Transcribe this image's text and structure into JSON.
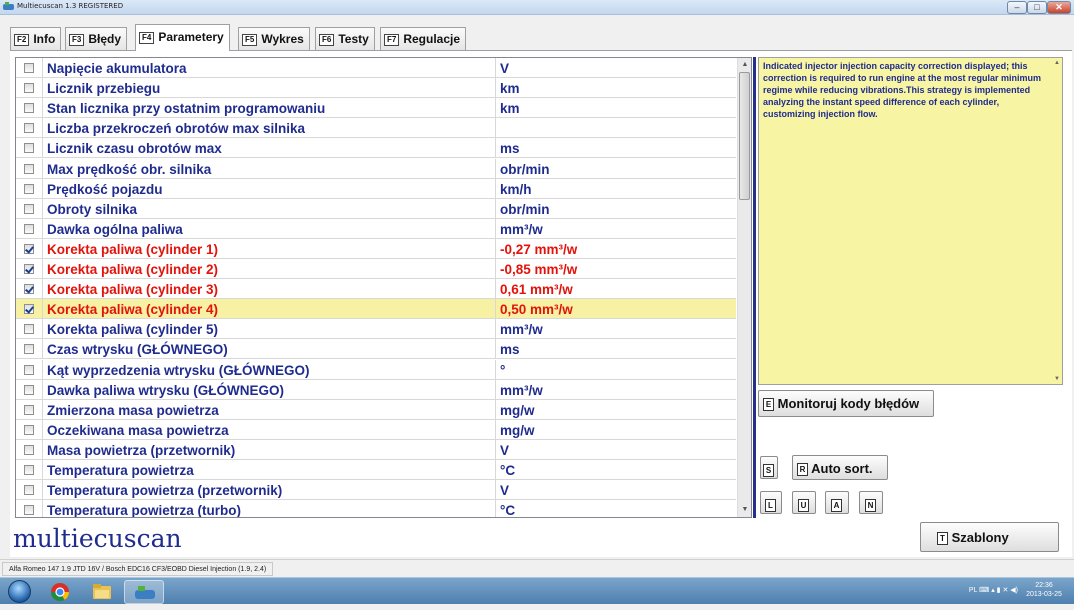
{
  "window": {
    "title": "Multiecuscan 1.3 REGISTERED",
    "minimize_glyph": "–",
    "maximize_glyph": "□",
    "close_glyph": "✕"
  },
  "tabs": [
    {
      "key": "F2",
      "label": "Info"
    },
    {
      "key": "F3",
      "label": "Błędy"
    },
    {
      "key": "F4",
      "label": "Parametery"
    },
    {
      "key": "F5",
      "label": "Wykres"
    },
    {
      "key": "F6",
      "label": "Testy"
    },
    {
      "key": "F7",
      "label": "Regulacje"
    }
  ],
  "params": [
    {
      "name": "Napięcie akumulatora",
      "value": "V",
      "checked": false
    },
    {
      "name": "Licznik przebiegu",
      "value": "km",
      "checked": false
    },
    {
      "name": "Stan licznika przy ostatnim programowaniu",
      "value": "km",
      "checked": false
    },
    {
      "name": "Liczba przekroczeń obrotów max silnika",
      "value": "",
      "checked": false
    },
    {
      "name": "Licznik czasu obrotów max",
      "value": "ms",
      "checked": false
    },
    {
      "name": "Max prędkość obr. silnika",
      "value": "obr/min",
      "checked": false
    },
    {
      "name": "Prędkość pojazdu",
      "value": "km/h",
      "checked": false
    },
    {
      "name": "Obroty silnika",
      "value": "obr/min",
      "checked": false
    },
    {
      "name": "Dawka ogólna paliwa",
      "value": "mm³/w",
      "checked": false
    },
    {
      "name": "Korekta paliwa (cylinder 1)",
      "value": "-0,27 mm³/w",
      "checked": true
    },
    {
      "name": "Korekta paliwa (cylinder 2)",
      "value": "-0,85 mm³/w",
      "checked": true
    },
    {
      "name": "Korekta paliwa (cylinder 3)",
      "value": "0,61 mm³/w",
      "checked": true
    },
    {
      "name": "Korekta paliwa (cylinder 4)",
      "value": "0,50 mm³/w",
      "checked": true,
      "selected": true
    },
    {
      "name": "Korekta paliwa (cylinder 5)",
      "value": "mm³/w",
      "checked": false
    },
    {
      "name": "Czas wtrysku (GŁÓWNEGO)",
      "value": "ms",
      "checked": false
    },
    {
      "name": "Kąt wyprzedzenia wtrysku (GŁÓWNEGO)",
      "value": "°",
      "checked": false
    },
    {
      "name": "Dawka paliwa wtrysku (GŁÓWNEGO)",
      "value": "mm³/w",
      "checked": false
    },
    {
      "name": "Zmierzona masa powietrza",
      "value": "mg/w",
      "checked": false
    },
    {
      "name": "Oczekiwana masa powietrza",
      "value": "mg/w",
      "checked": false
    },
    {
      "name": "Masa powietrza (przetwornik)",
      "value": "V",
      "checked": false
    },
    {
      "name": "Temperatura powietrza",
      "value": "°C",
      "checked": false
    },
    {
      "name": "Temperatura powietrza (przetwornik)",
      "value": "V",
      "checked": false
    },
    {
      "name": "Temperatura powietrza (turbo)",
      "value": "°C",
      "checked": false
    }
  ],
  "description": "Indicated injector injection capacity correction displayed; this correction is required to run engine at the most regular minimum regime while reducing vibrations.This strategy is implemented analyzing the instant speed difference of each cylinder, customizing injection flow.",
  "buttons": {
    "monitor": {
      "key": "E",
      "label": "Monitoruj kody błędów"
    },
    "s": {
      "key": "S"
    },
    "autosort": {
      "key": "R",
      "label": "Auto sort."
    },
    "l": {
      "key": "L"
    },
    "u": {
      "key": "U"
    },
    "a": {
      "key": "A"
    },
    "n": {
      "key": "N"
    },
    "templates": {
      "key": "T",
      "label": "Szablony"
    }
  },
  "logo": "multiecuscan",
  "status": "Alfa Romeo 147 1.9 JTD 16V / Bosch EDC16 CF3/EOBD Diesel Injection (1.9, 2.4)",
  "taskbar": {
    "lang": "PL",
    "time": "22:36",
    "date": "2013-03-25"
  },
  "colors": {
    "accent": "#1f2c8e",
    "active_value": "#e3120b",
    "selected_row": "#f7f1a4",
    "description_bg": "#f7f4a4"
  }
}
